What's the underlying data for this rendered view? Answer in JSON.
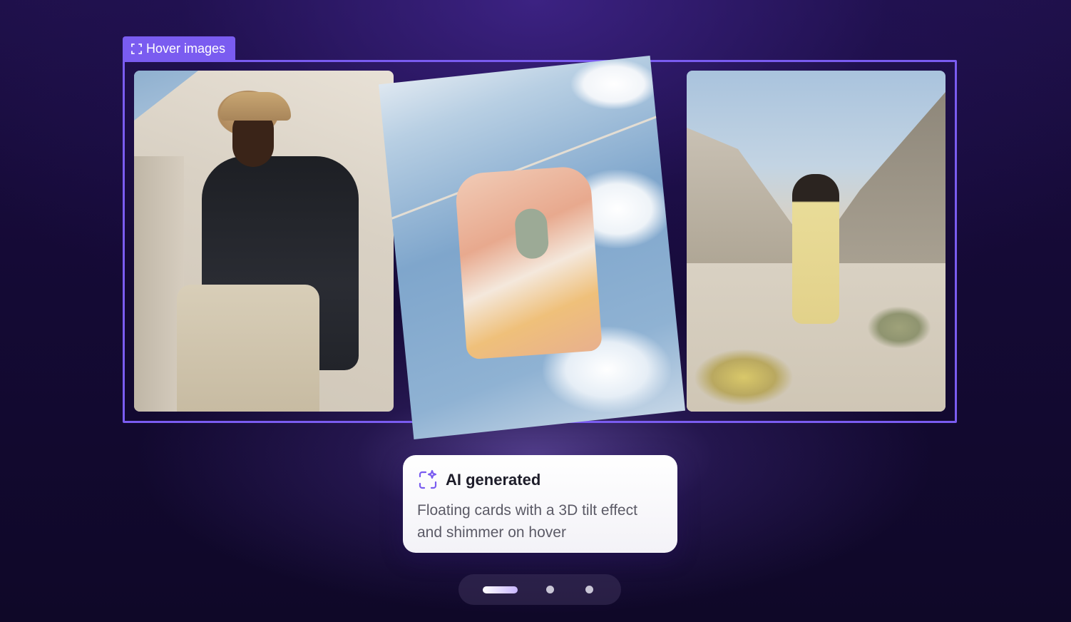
{
  "frame": {
    "label": "Hover images"
  },
  "cards": [
    {
      "subject": "man in black shirt and bucket hat"
    },
    {
      "subject": "patchwork shirt hanging on clothesline"
    },
    {
      "subject": "woman in yellow dress in desert valley"
    }
  ],
  "info": {
    "icon": "ai-sparkle-icon",
    "title": "AI generated",
    "description": "Floating cards with a 3D tilt effect and shimmer on hover"
  },
  "pager": {
    "total": 3,
    "active_index": 0
  },
  "colors": {
    "accent": "#7a5cf0",
    "background": "#150a36"
  }
}
